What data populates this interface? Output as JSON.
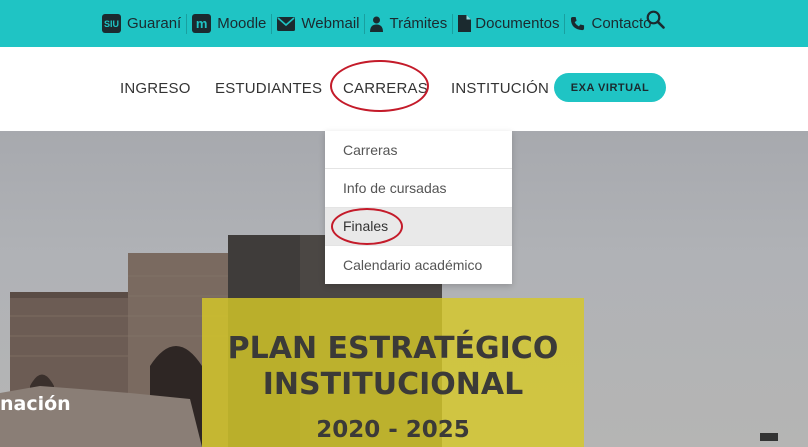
{
  "topbar": {
    "links": [
      {
        "label": "Guaraní",
        "icon": "siu-icon",
        "icon_text": "SIU"
      },
      {
        "label": "Moodle",
        "icon": "moodle-icon",
        "icon_text": "m"
      },
      {
        "label": "Webmail",
        "icon": "envelope-icon"
      },
      {
        "label": "Trámites",
        "icon": "user-icon"
      },
      {
        "label": "Documentos",
        "icon": "document-icon"
      },
      {
        "label": "Contacto",
        "icon": "phone-icon"
      }
    ],
    "search_icon": "search-icon"
  },
  "nav": {
    "items": [
      "INGRESO",
      "ESTUDIANTES",
      "CARRERAS",
      "INSTITUCIÓN"
    ],
    "cta": "EXA VIRTUAL"
  },
  "dropdown": {
    "items": [
      "Carreras",
      "Info de cursadas",
      "Finales",
      "Calendario académico"
    ],
    "active_index": 2
  },
  "hero": {
    "side_text": "nación",
    "title_line1": "PLAN ESTRATÉGICO",
    "title_line2": "INSTITUCIONAL",
    "years": "2020 - 2025"
  },
  "colors": {
    "accent": "#1fc4c4",
    "highlight_ring": "#c41b2a",
    "banner": "#d6c828"
  }
}
